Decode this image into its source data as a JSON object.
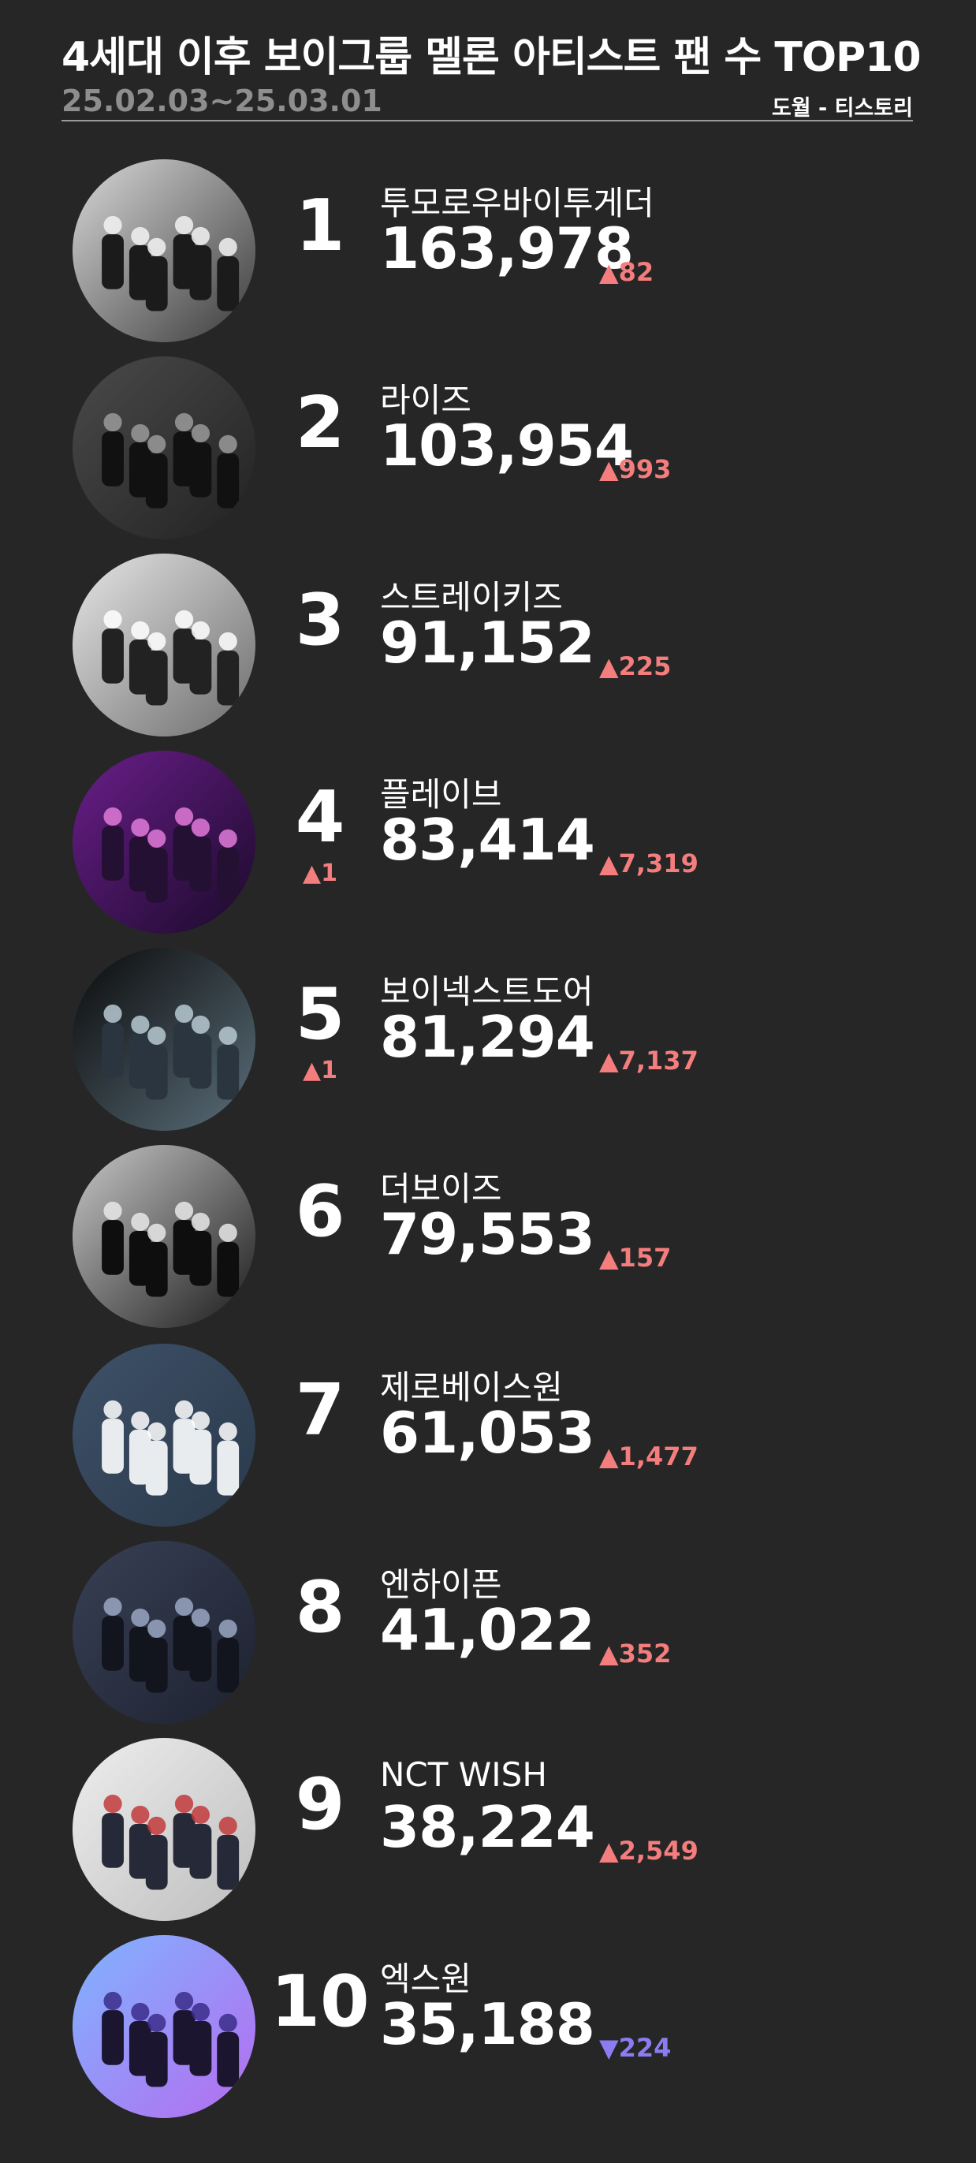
{
  "header": {
    "title": "4세대 이후 보이그룹 멜론 아티스트 팬 수 TOP10",
    "date_range": "25.02.03~25.03.01",
    "credit": "도월 - 티스토리"
  },
  "colors": {
    "background": "#262626",
    "up": "#f47d7d",
    "down": "#8b7cf2",
    "muted": "#8e8e8e"
  },
  "rows": [
    {
      "rank": "1",
      "rank_change": "",
      "name": "투모로우바이투게더",
      "fans": "163,978",
      "delta": "▲82",
      "direction": "up",
      "photo_icon": "group-photo-icon"
    },
    {
      "rank": "2",
      "rank_change": "",
      "name": "라이즈",
      "fans": "103,954",
      "delta": "▲993",
      "direction": "up",
      "photo_icon": "group-photo-icon"
    },
    {
      "rank": "3",
      "rank_change": "",
      "name": "스트레이키즈",
      "fans": "91,152",
      "delta": "▲225",
      "direction": "up",
      "photo_icon": "group-photo-icon"
    },
    {
      "rank": "4",
      "rank_change": "▲1",
      "name": "플레이브",
      "fans": "83,414",
      "delta": "▲7,319",
      "direction": "up",
      "photo_icon": "group-photo-icon"
    },
    {
      "rank": "5",
      "rank_change": "▲1",
      "name": "보이넥스트도어",
      "fans": "81,294",
      "delta": "▲7,137",
      "direction": "up",
      "photo_icon": "group-photo-icon"
    },
    {
      "rank": "6",
      "rank_change": "",
      "name": "더보이즈",
      "fans": "79,553",
      "delta": "▲157",
      "direction": "up",
      "photo_icon": "group-photo-icon"
    },
    {
      "rank": "7",
      "rank_change": "",
      "name": "제로베이스원",
      "fans": "61,053",
      "delta": "▲1,477",
      "direction": "up",
      "photo_icon": "group-photo-icon"
    },
    {
      "rank": "8",
      "rank_change": "",
      "name": "엔하이픈",
      "fans": "41,022",
      "delta": "▲352",
      "direction": "up",
      "photo_icon": "group-photo-icon"
    },
    {
      "rank": "9",
      "rank_change": "",
      "name": "NCT WISH",
      "fans": "38,224",
      "delta": "▲2,549",
      "direction": "up",
      "photo_icon": "group-photo-icon"
    },
    {
      "rank": "10",
      "rank_change": "",
      "name": "엑스원",
      "fans": "35,188",
      "delta": "▼224",
      "direction": "down",
      "photo_icon": "group-photo-icon"
    }
  ]
}
